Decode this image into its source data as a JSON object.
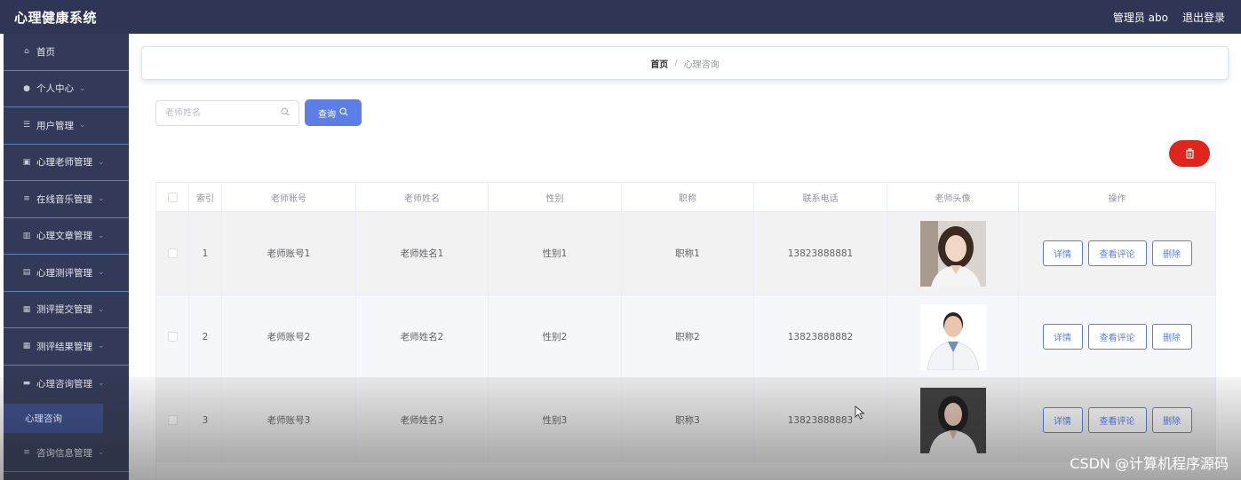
{
  "app": {
    "title": "心理健康系统"
  },
  "header": {
    "admin_label": "管理员 abo",
    "logout_label": "退出登录"
  },
  "sidebar": {
    "items": [
      {
        "label": "首页",
        "icon": "home-icon",
        "has_chevron": false
      },
      {
        "label": "个人中心",
        "icon": "user-icon",
        "has_chevron": true
      },
      {
        "label": "用户管理",
        "icon": "users-icon",
        "has_chevron": true
      },
      {
        "label": "心理老师管理",
        "icon": "teacher-icon",
        "has_chevron": true
      },
      {
        "label": "在线音乐管理",
        "icon": "list-icon",
        "has_chevron": true
      },
      {
        "label": "心理文章管理",
        "icon": "chart-icon",
        "has_chevron": true
      },
      {
        "label": "心理测评管理",
        "icon": "clipboard-icon",
        "has_chevron": true
      },
      {
        "label": "测评提交管理",
        "icon": "grid-icon",
        "has_chevron": true
      },
      {
        "label": "测评结果管理",
        "icon": "grid-icon",
        "has_chevron": true
      },
      {
        "label": "心理咨询管理",
        "icon": "message-icon",
        "has_chevron": true
      }
    ],
    "active_sub_item": "心理咨询",
    "last_item": {
      "label": "咨询信息管理",
      "icon": "list-icon",
      "has_chevron": true
    }
  },
  "breadcrumb": {
    "home": "首页",
    "separator": "/",
    "current": "心理咨询"
  },
  "search": {
    "placeholder": "老师姓名",
    "button_label": "查询"
  },
  "table": {
    "headers": [
      "索引",
      "老师账号",
      "老师姓名",
      "性别",
      "职称",
      "联系电话",
      "老师头像",
      "操作"
    ],
    "rows": [
      {
        "index": "1",
        "account": "老师账号1",
        "name": "老师姓名1",
        "gender": "性别1",
        "title": "职称1",
        "phone": "13823888881",
        "avatar": "female-doctor"
      },
      {
        "index": "2",
        "account": "老师账号2",
        "name": "老师姓名2",
        "gender": "性别2",
        "title": "职称2",
        "phone": "13823888882",
        "avatar": "male-doctor"
      },
      {
        "index": "3",
        "account": "老师账号3",
        "name": "老师姓名3",
        "gender": "性别3",
        "title": "职称3",
        "phone": "13823888883",
        "avatar": "female-doctor-dark"
      }
    ],
    "actions": {
      "detail": "详情",
      "review": "查看评论",
      "delete": "删除"
    }
  },
  "watermark": "CSDN @计算机程序源码",
  "colors": {
    "topbar": "#2f3655",
    "sidebar": "#323a57",
    "primary": "#5b7fe6",
    "danger": "#e0251c"
  }
}
